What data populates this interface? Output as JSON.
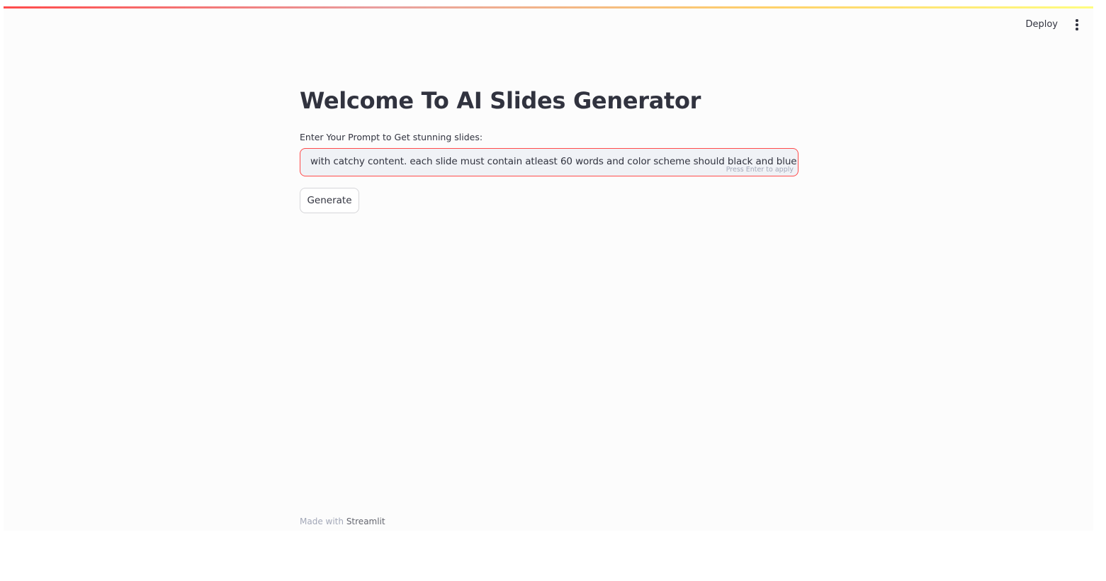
{
  "header": {
    "deploy_label": "Deploy",
    "menu_icon": "vertical-ellipsis-icon",
    "decoration_colors": [
      "#ff4b4b",
      "#ffd16a",
      "#fffd80"
    ]
  },
  "main": {
    "title": "Welcome To AI Slides Generator",
    "prompt_label": "Enter Your Prompt to Get stunning slides:",
    "prompt_value": "with catchy content. each slide must contain atleast 60 words and color scheme should black and blue",
    "prompt_hint": "Press Enter to apply",
    "generate_label": "Generate"
  },
  "footer": {
    "made_with": "Made with",
    "brand": "Streamlit"
  },
  "colors": {
    "accent": "#ff4b4b",
    "text": "#31333f",
    "input_bg": "#f0f2f6",
    "muted": "#a3a8b8"
  }
}
